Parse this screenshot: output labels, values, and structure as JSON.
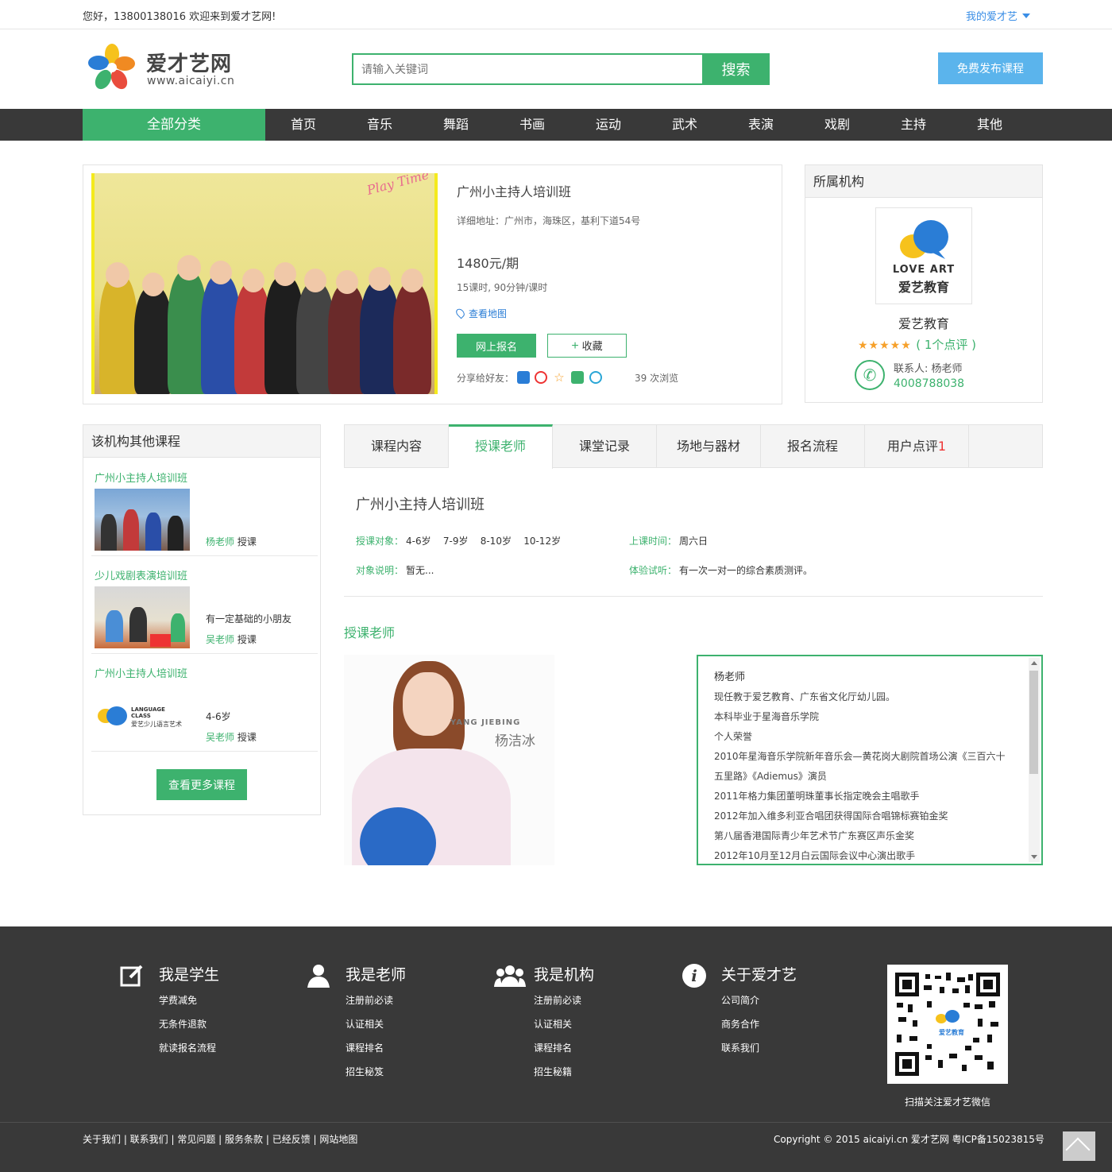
{
  "topbar": {
    "greeting": "您好，13800138016 欢迎来到爱才艺网!",
    "my_link": "我的爱才艺"
  },
  "header": {
    "logo_name": "爱才艺网",
    "logo_url": "www.aicaiyi.cn",
    "search_placeholder": "请输入关键词",
    "search_button": "搜索",
    "publish_button": "免费发布课程"
  },
  "nav": {
    "all": "全部分类",
    "items": [
      "首页",
      "音乐",
      "舞蹈",
      "书画",
      "运动",
      "武术",
      "表演",
      "戏剧",
      "主持",
      "其他"
    ]
  },
  "course": {
    "title": "广州小主持人培训班",
    "address": "详细地址：广州市，海珠区，基利下道54号",
    "price": "1480元/期",
    "hours": "15课时, 90分钟/课时",
    "map_link": "查看地图",
    "signup_button": "网上报名",
    "fav_plus": "+",
    "fav_button": "收藏",
    "share_label": "分享给好友：",
    "views": "39 次浏览",
    "photo_text": "Play Time"
  },
  "org": {
    "header": "所属机构",
    "logo_text": "LOVE ART",
    "logo_cn": "爱艺教育",
    "name": "爱艺教育",
    "stars": "★★★★★",
    "review_count": "( 1个点评 )",
    "rating": 5,
    "contact": "联系人: 杨老师",
    "phone": "4008788038"
  },
  "other_courses": {
    "header": "该机构其他课程",
    "items": [
      {
        "title": "广州小主持人培训班",
        "line1": "",
        "teacher": "杨老师",
        "suffix": "授课"
      },
      {
        "title": "少儿戏剧表演培训班",
        "line1": "有一定基础的小朋友",
        "teacher": "吴老师",
        "suffix": "授课"
      },
      {
        "title": "广州小主持人培训班",
        "line1": "4-6岁",
        "teacher": "吴老师",
        "suffix": "授课"
      }
    ],
    "third_img_text": "LANGUAGE CLASS",
    "third_img_cn": "爱艺少儿语言艺术",
    "more_button": "查看更多课程"
  },
  "tabs": [
    {
      "label": "课程内容",
      "badge": ""
    },
    {
      "label": "授课老师",
      "badge": ""
    },
    {
      "label": "课堂记录",
      "badge": ""
    },
    {
      "label": "场地与器材",
      "badge": ""
    },
    {
      "label": "报名流程",
      "badge": ""
    },
    {
      "label": "用户点评",
      "badge": "1"
    }
  ],
  "detail": {
    "title": "广州小主持人培训班",
    "target_label": "授课对象：",
    "target_value": "4-6岁    7-9岁    8-10岁    10-12岁",
    "time_label": "上课时间：",
    "time_value": "周六日",
    "desc_label": "对象说明：",
    "desc_value": "暂无...",
    "trial_label": "体验试听：",
    "trial_value": "有一次一对一的综合素质测评。"
  },
  "teacher": {
    "section_title": "授课老师",
    "photo_en": "YANG JIEBING",
    "photo_cn": "杨洁冰",
    "bio": [
      "杨老师",
      "现任教于爱艺教育、广东省文化厅幼儿园。",
      "本科毕业于星海音乐学院",
      "个人荣誉",
      "2010年星海音乐学院新年音乐会—黄花岗大剧院首场公演《三百六十",
      "五里路》《Adiemus》演员",
      "2011年格力集团董明珠董事长指定晚会主唱歌手",
      "2012年加入维多利亚合唱团获得国际合唱锦标赛铂金奖",
      "第八届香港国际青少年艺术节广东赛区声乐金奖",
      "2012年10月至12月白云国际会议中心演出歌手"
    ]
  },
  "footer": {
    "columns": [
      {
        "title": "我是学生",
        "icon": "edit-icon",
        "links": [
          "学费减免",
          "无条件退款",
          "就读报名流程"
        ]
      },
      {
        "title": "我是老师",
        "icon": "user-icon",
        "links": [
          "注册前必读",
          "认证相关",
          "课程排名",
          "招生秘笈"
        ]
      },
      {
        "title": "我是机构",
        "icon": "group-icon",
        "links": [
          "注册前必读",
          "认证相关",
          "课程排名",
          "招生秘籍"
        ]
      },
      {
        "title": "关于爱才艺",
        "icon": "info-icon",
        "links": [
          "公司简介",
          "商务合作",
          "联系我们"
        ]
      }
    ],
    "qr_center": "爱艺教育",
    "qr_caption": "扫描关注爱才艺微信",
    "bottom_links": "关于我们 | 联系我们 | 常见问题 | 服务条款 | 已经反馈 | 网站地图",
    "copyright": "Copyright © 2015 aicaiyi.cn 爱才艺网 粤ICP备15023815号"
  },
  "colors": {
    "accent": "#3db26e",
    "nav": "#393939",
    "publish": "#5bb4ec",
    "stars": "#f6a02a",
    "link": "#3a8ee6"
  }
}
